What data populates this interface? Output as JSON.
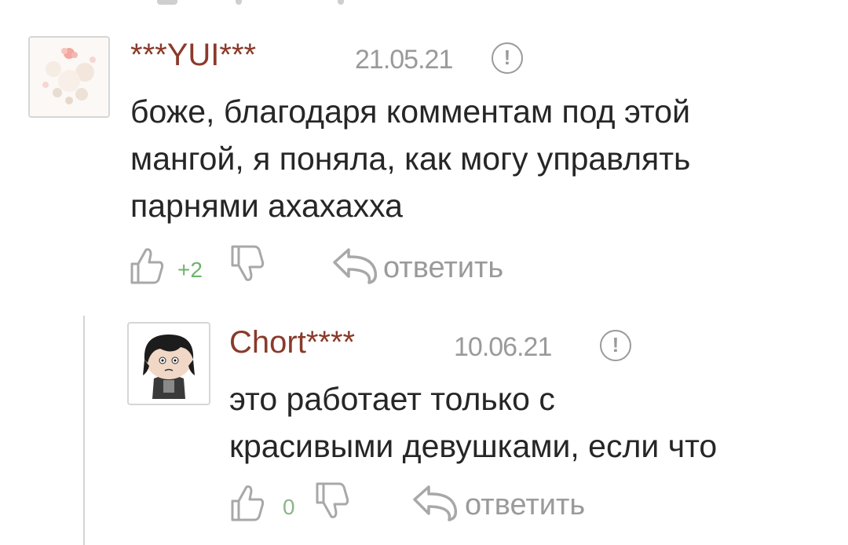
{
  "comments": [
    {
      "author": "***YUI***",
      "date": "21.05.21",
      "report_icon": "exclamation-circle-icon",
      "text_lines": [
        "боже, благодаря комментам под этой",
        "мангой, я поняла, как могу управлять",
        "парнями ахахахха"
      ],
      "score": "+2",
      "reply_label": "ответить"
    },
    {
      "author": "Chort****",
      "date": "10.06.21",
      "report_icon": "exclamation-circle-icon",
      "text_lines": [
        "это работает только с",
        "красивыми девушками, если что"
      ],
      "score": "0",
      "reply_label": "ответить"
    }
  ],
  "colors": {
    "author": "#8a3a2a",
    "meta": "#9a9a9a",
    "score": "#6cb56c",
    "text": "#262626"
  },
  "icons": {
    "like": "thumbs-up-icon",
    "dislike": "thumbs-down-icon",
    "reply": "reply-arrow-icon"
  }
}
